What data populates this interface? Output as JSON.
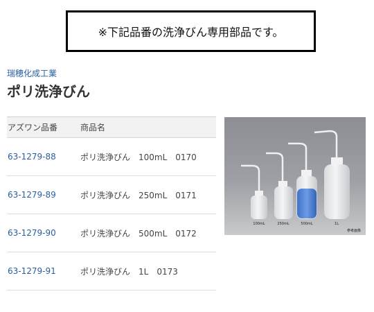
{
  "notice": {
    "text": "※下記品番の洗浄びん専用部品です。"
  },
  "product": {
    "maker": "瑞穂化成工業",
    "title": "ポリ洗浄びん"
  },
  "table": {
    "headers": [
      "アズワン品番",
      "商品名"
    ],
    "rows": [
      {
        "code": "63-1279-88",
        "name": "ポリ洗浄びん　100mL　0170"
      },
      {
        "code": "63-1279-89",
        "name": "ポリ洗浄びん　250mL　0171"
      },
      {
        "code": "63-1279-90",
        "name": "ポリ洗浄びん　500mL　0172"
      },
      {
        "code": "63-1279-91",
        "name": "ポリ洗浄びん　1L　0173"
      }
    ]
  },
  "photo": {
    "labels": [
      "100mL",
      "250mL",
      "500mL",
      "1L"
    ],
    "note": "参考画像"
  },
  "colors": {
    "link": "#2a5f9e",
    "header_bg": "#f2f2f2",
    "border": "#000000"
  }
}
